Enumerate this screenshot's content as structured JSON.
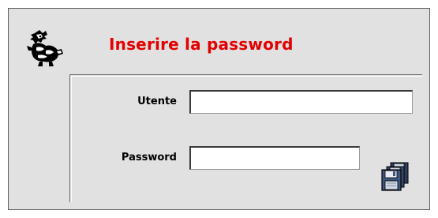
{
  "dialog": {
    "title": "Inserire la password",
    "title_color": "#e30000",
    "icon": "mascot-logo-icon"
  },
  "form": {
    "user_label": "Utente",
    "user_value": "",
    "password_label": "Password",
    "password_value": ""
  },
  "actions": {
    "save_icon": "floppy-disk-icon"
  }
}
